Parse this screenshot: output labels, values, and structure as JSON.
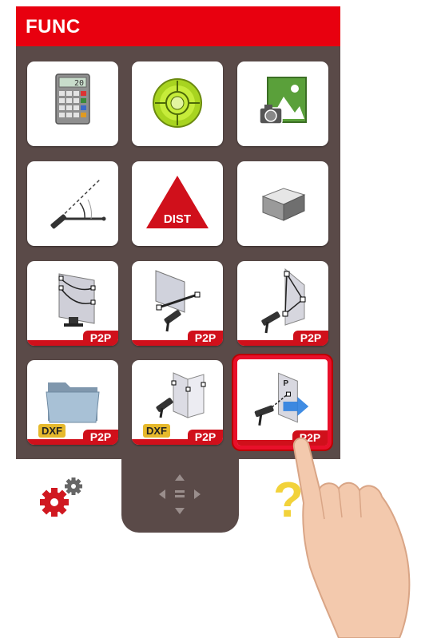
{
  "header": {
    "title": "FUNC"
  },
  "tiles": [
    {
      "id": "calculator",
      "icon": "calculator-icon",
      "display_value": "20"
    },
    {
      "id": "level",
      "icon": "level-bubble-icon"
    },
    {
      "id": "photo",
      "icon": "camera-photo-icon"
    },
    {
      "id": "angle",
      "icon": "angle-measure-icon"
    },
    {
      "id": "distance",
      "icon": "dist-triangle-icon",
      "label": "DIST"
    },
    {
      "id": "volume",
      "icon": "cube-volume-icon"
    },
    {
      "id": "p2p-area",
      "icon": "p2p-area-icon",
      "badge": "P2P"
    },
    {
      "id": "p2p-distance",
      "icon": "p2p-distance-icon",
      "badge": "P2P"
    },
    {
      "id": "p2p-triangle",
      "icon": "p2p-triangle-icon",
      "badge": "P2P"
    },
    {
      "id": "dxf-folder",
      "icon": "folder-icon",
      "tag": "DXF",
      "badge": "P2P"
    },
    {
      "id": "dxf-plan",
      "icon": "dxf-plan-icon",
      "tag": "DXF",
      "badge": "P2P"
    },
    {
      "id": "p2p-point",
      "icon": "p2p-point-icon",
      "badge": "P2P",
      "point_label": "P",
      "selected": true
    }
  ],
  "bottom": {
    "settings_icon": "gear-icon",
    "navigation_icon": "dpad-icon",
    "help_icon": "question-icon",
    "help_label": "?"
  },
  "colors": {
    "header": "#e8000f",
    "panel": "#5a4a48",
    "badge": "#d0101b",
    "dxf": "#e6b92c",
    "help": "#f2d23a"
  }
}
